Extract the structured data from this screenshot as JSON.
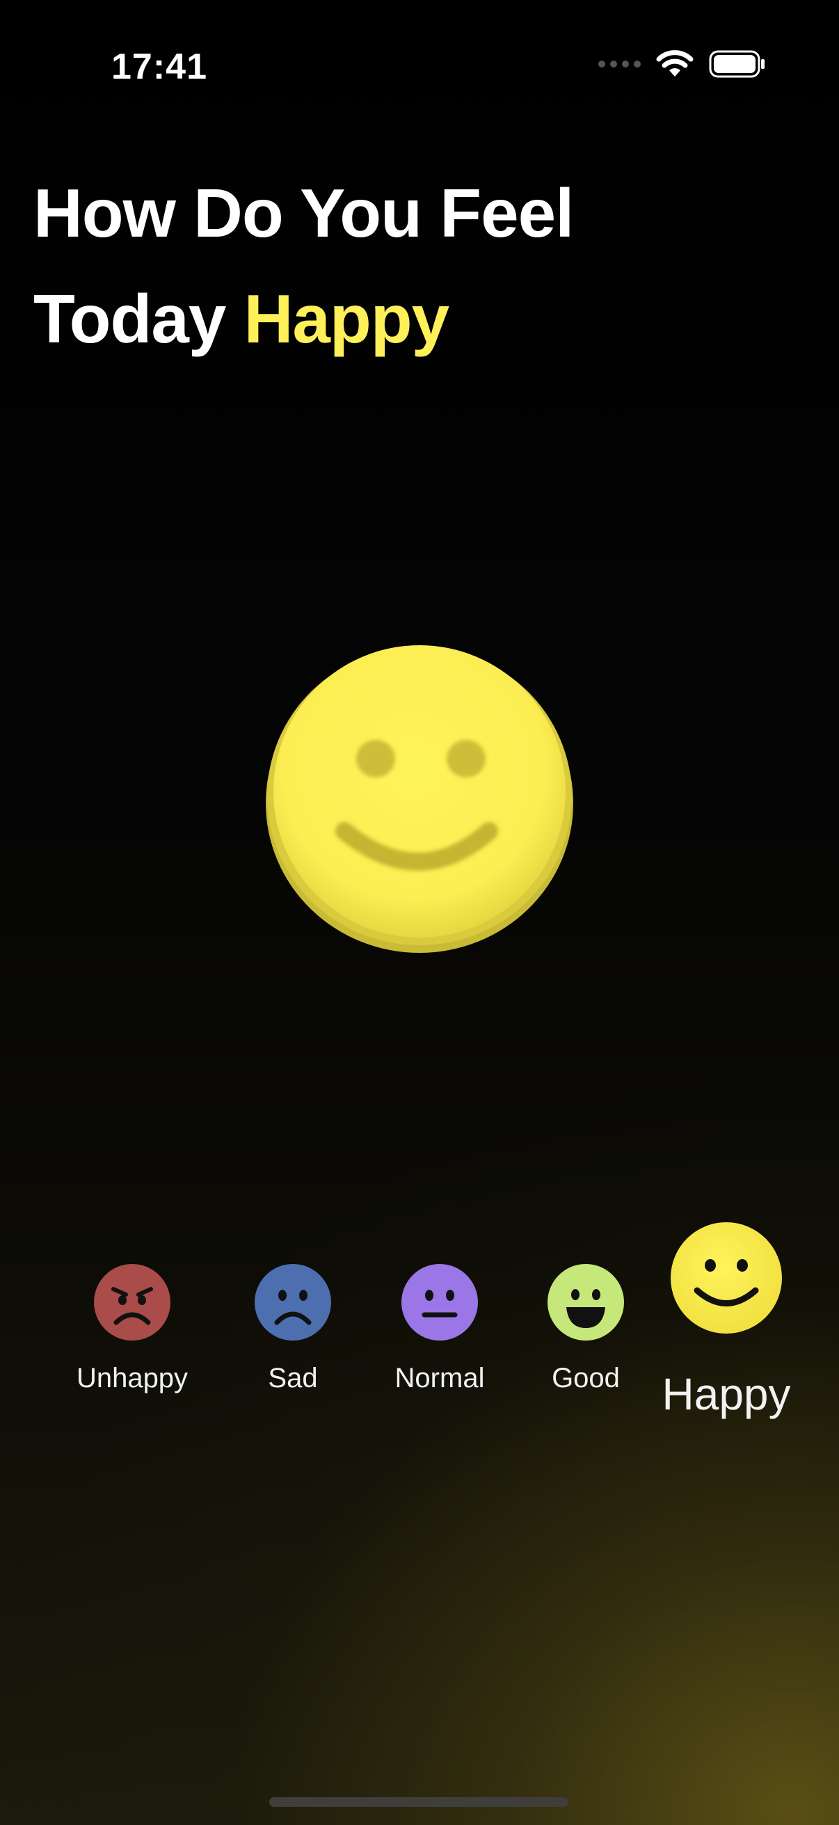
{
  "status_bar": {
    "time": "17:41"
  },
  "header": {
    "line1": "How Do You Feel",
    "line2_prefix": "Today",
    "current_mood": "Happy"
  },
  "colors": {
    "background": "#000000",
    "accent": "#fff05a",
    "unhappy": "#a94c4a",
    "sad": "#4d6fb0",
    "normal": "#9a76e6",
    "good": "#c6e87a",
    "happy": "#fff04a"
  },
  "moods": [
    {
      "label": "Unhappy",
      "icon": "angry-face-icon"
    },
    {
      "label": "Sad",
      "icon": "sad-face-icon"
    },
    {
      "label": "Normal",
      "icon": "neutral-face-icon"
    },
    {
      "label": "Good",
      "icon": "grinning-face-icon"
    },
    {
      "label": "Happy",
      "icon": "smiling-face-icon",
      "selected": true
    }
  ]
}
